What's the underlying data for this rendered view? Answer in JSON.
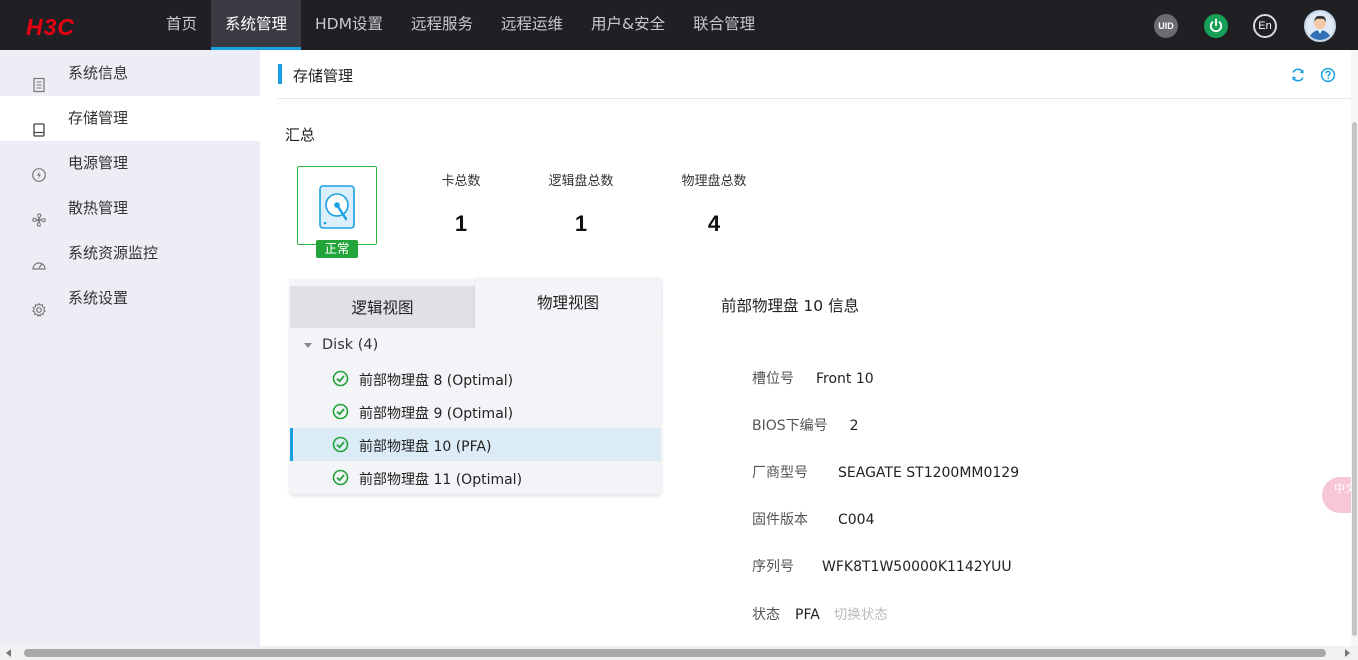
{
  "brand": {
    "logo": "H3C",
    "logo_color": "#e60012"
  },
  "nav": {
    "items": [
      "首页",
      "系统管理",
      "HDM设置",
      "远程服务",
      "远程运维",
      "用户&安全",
      "联合管理"
    ],
    "active": "系统管理",
    "uid_label": "UID",
    "lang_label": "En"
  },
  "sidebar": {
    "items": [
      {
        "label": "系统信息",
        "icon": "document-list-icon"
      },
      {
        "label": "存储管理",
        "icon": "hard-drive-icon"
      },
      {
        "label": "电源管理",
        "icon": "power-bolt-icon"
      },
      {
        "label": "散热管理",
        "icon": "fan-icon"
      },
      {
        "label": "系统资源监控",
        "icon": "gauge-icon"
      },
      {
        "label": "系统设置",
        "icon": "gear-icon"
      }
    ],
    "active": "存储管理"
  },
  "page": {
    "title": "存储管理",
    "section_summary": "汇总",
    "status_badge": "正常",
    "stats": [
      {
        "label": "卡总数",
        "value": "1"
      },
      {
        "label": "逻辑盘总数",
        "value": "1"
      },
      {
        "label": "物理盘总数",
        "value": "4"
      }
    ]
  },
  "tabs": {
    "logical": "逻辑视图",
    "physical": "物理视图",
    "active": "物理视图"
  },
  "tree": {
    "root": "Disk (4)",
    "disks": [
      {
        "label": "前部物理盘 8 (Optimal)",
        "selected": false
      },
      {
        "label": "前部物理盘 9 (Optimal)",
        "selected": false
      },
      {
        "label": "前部物理盘 10 (PFA)",
        "selected": true
      },
      {
        "label": "前部物理盘 11 (Optimal)",
        "selected": false
      }
    ]
  },
  "detail": {
    "title": "前部物理盘 10 信息",
    "slot_label": "槽位号",
    "slot_value": "Front 10",
    "bios_label": "BIOS下编号",
    "bios_value": "2",
    "vendor_label": "厂商型号",
    "vendor_value": "SEAGATE ST1200MM0129",
    "firmware_label": "固件版本",
    "firmware_value": "C004",
    "serial_label": "序列号",
    "serial_value": "WFK8T1W50000K1142YUU",
    "state_label": "状态",
    "state_value": "PFA",
    "switch_state": "切换状态"
  },
  "float_button": "中文",
  "colors": {
    "accent": "#1aa0e0",
    "ok_green": "#23a43a",
    "topbar": "#1f1f24",
    "sidebar": "#edeef5"
  }
}
